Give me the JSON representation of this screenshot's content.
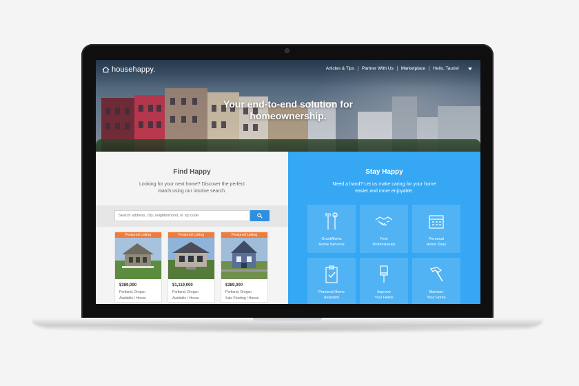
{
  "nav": {
    "logo_text": "househappy.",
    "links": [
      "Articles & Tips",
      "Partner With Us",
      "Marketplace",
      "Hello, Taurie!"
    ]
  },
  "hero": {
    "title_line1": "Your end-to-end solution for",
    "title_line2": "homeownership."
  },
  "find": {
    "title": "Find Happy",
    "description": "Looking for your next home? Discover the perfect match using our intutive search.",
    "search_placeholder": "Search address, city, neighborhood, or zip code",
    "search_icon": "search-icon",
    "listings": [
      {
        "tag": "Featured Listing",
        "price": "$389,000",
        "location": "Portland, Oregon",
        "status": "Available / House"
      },
      {
        "tag": "Featured Listing",
        "price": "$1,119,000",
        "location": "Portland, Oregon",
        "status": "Available / House"
      },
      {
        "tag": "Featured Listing",
        "price": "$389,000",
        "location": "Portland, Oregon",
        "status": "Sale Pending / House"
      }
    ]
  },
  "stay": {
    "title": "Stay Happy",
    "description": "Need a hand? Let us make caring for your home easier and more enjoyable.",
    "services": [
      {
        "line1": "GruntWorks",
        "line2": "Home Services",
        "icon": "tools-icon"
      },
      {
        "line1": "Find",
        "line2": "Professionals",
        "icon": "handshake-icon"
      },
      {
        "line1": "Personal",
        "line2": "Home Diary",
        "icon": "calendar-icon"
      },
      {
        "line1": "Personal Home",
        "line2": "Assistant",
        "icon": "clipboard-check-icon"
      },
      {
        "line1": "Improve",
        "line2": "Your Home",
        "icon": "paintbrush-icon"
      },
      {
        "line1": "Maintain",
        "line2": "Your Home",
        "icon": "hammer-icon"
      }
    ]
  },
  "colors": {
    "accent_blue": "#35a7f3",
    "search_button": "#2d8fde",
    "featured_tag": "#f07c3b"
  }
}
